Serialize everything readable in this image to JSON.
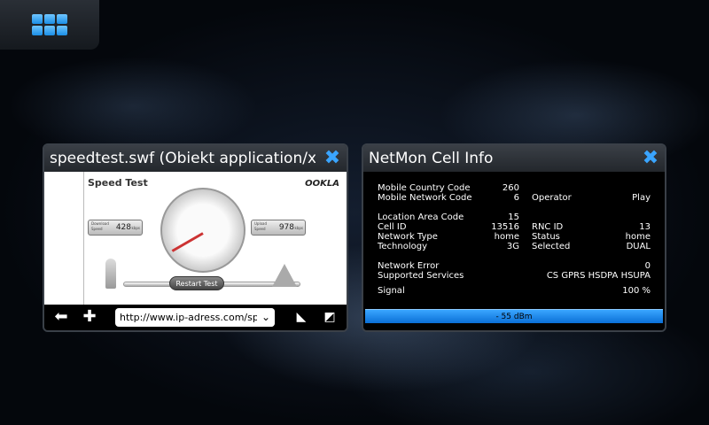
{
  "launcher": {
    "icon": "app-grid-icon"
  },
  "browser_window": {
    "title": "speedtest.swf (Obiekt application/x-shockwave-flash)",
    "close_icon": "close-icon",
    "speedtest": {
      "title": "Speed Test",
      "brand": "OOKLA",
      "download_label": "Download Speed",
      "download_value": "428",
      "download_unit": "kbps",
      "upload_label": "Upload Speed",
      "upload_value": "978",
      "upload_unit": "kbps",
      "restart_label": "Restart Test"
    },
    "toolbar": {
      "back_icon": "back-arrow-icon",
      "add_icon": "plus-icon",
      "url": "http://www.ip-adress.com/speedtest/",
      "fullscreen_icon": "fullscreen-icon",
      "window_icon": "window-switch-icon"
    }
  },
  "netmon_window": {
    "title": "NetMon Cell Info",
    "close_icon": "close-icon",
    "fields": {
      "mcc_label": "Mobile Country Code",
      "mcc_value": "260",
      "mnc_label": "Mobile Network Code",
      "mnc_value": "6",
      "operator_label": "Operator",
      "operator_value": "Play",
      "lac_label": "Location Area Code",
      "lac_value": "15",
      "cellid_label": "Cell ID",
      "cellid_value": "13516",
      "rnc_label": "RNC ID",
      "rnc_value": "13",
      "nettype_label": "Network Type",
      "nettype_value": "home",
      "status_label": "Status",
      "status_value": "home",
      "tech_label": "Technology",
      "tech_value": "3G",
      "selected_label": "Selected",
      "selected_value": "DUAL",
      "neterror_label": "Network Error",
      "neterror_value": "0",
      "services_label": "Supported Services",
      "services_value": "CS GPRS HSDPA HSUPA",
      "signal_label": "Signal",
      "signal_value": "100 %"
    },
    "signal_bar": "- 55 dBm",
    "signal_fraction": 1.0
  }
}
